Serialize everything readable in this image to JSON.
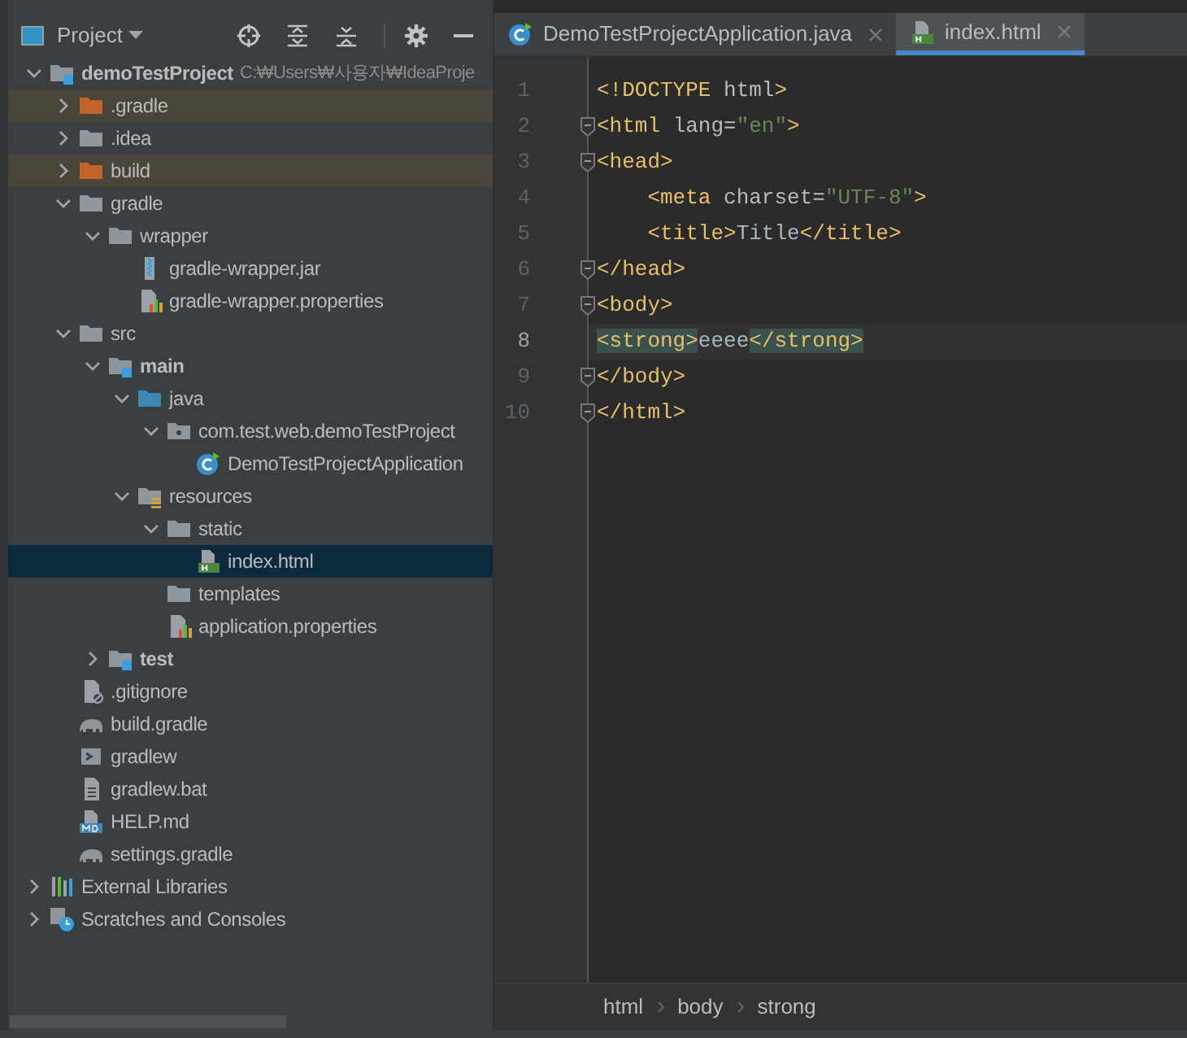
{
  "project_panel": {
    "title": "Project",
    "tree": [
      {
        "name": "demoTestProject",
        "kind": "module",
        "hint": "C:₩Users₩사용자₩IdeaProje",
        "expanded": true,
        "selected": false,
        "children": [
          {
            "name": ".gradle",
            "kind": "excluded-folder",
            "expanded": false,
            "selected": false
          },
          {
            "name": ".idea",
            "kind": "folder",
            "expanded": false,
            "selected": false
          },
          {
            "name": "build",
            "kind": "excluded-folder",
            "expanded": false,
            "selected": false
          },
          {
            "name": "gradle",
            "kind": "folder",
            "expanded": true,
            "selected": false,
            "children": [
              {
                "name": "wrapper",
                "kind": "folder",
                "expanded": true,
                "selected": false,
                "children": [
                  {
                    "name": "gradle-wrapper.jar",
                    "kind": "jar",
                    "selected": false
                  },
                  {
                    "name": "gradle-wrapper.properties",
                    "kind": "properties",
                    "selected": false
                  }
                ]
              }
            ]
          },
          {
            "name": "src",
            "kind": "folder",
            "expanded": true,
            "selected": false,
            "children": [
              {
                "name": "main",
                "kind": "module-folder",
                "expanded": true,
                "selected": false,
                "children": [
                  {
                    "name": "java",
                    "kind": "source-folder",
                    "expanded": true,
                    "selected": false,
                    "children": [
                      {
                        "name": "com.test.web.demoTestProject",
                        "kind": "package",
                        "expanded": true,
                        "selected": false,
                        "children": [
                          {
                            "name": "DemoTestProjectApplication",
                            "kind": "java-class",
                            "selected": false
                          }
                        ]
                      }
                    ]
                  },
                  {
                    "name": "resources",
                    "kind": "resources",
                    "expanded": true,
                    "selected": false,
                    "children": [
                      {
                        "name": "static",
                        "kind": "folder",
                        "expanded": true,
                        "selected": false,
                        "children": [
                          {
                            "name": "index.html",
                            "kind": "html",
                            "selected": true
                          }
                        ]
                      },
                      {
                        "name": "templates",
                        "kind": "folder",
                        "selected": false
                      },
                      {
                        "name": "application.properties",
                        "kind": "properties",
                        "selected": false
                      }
                    ]
                  }
                ]
              },
              {
                "name": "test",
                "kind": "module-folder",
                "expanded": false,
                "selected": false
              }
            ]
          },
          {
            "name": ".gitignore",
            "kind": "gitignore",
            "selected": false
          },
          {
            "name": "build.gradle",
            "kind": "gradle",
            "selected": false
          },
          {
            "name": "gradlew",
            "kind": "shell",
            "selected": false
          },
          {
            "name": "gradlew.bat",
            "kind": "bat",
            "selected": false
          },
          {
            "name": "HELP.md",
            "kind": "markdown",
            "selected": false
          },
          {
            "name": "settings.gradle",
            "kind": "gradle",
            "selected": false
          }
        ]
      },
      {
        "name": "External Libraries",
        "kind": "libraries",
        "expanded": false,
        "selected": false
      },
      {
        "name": "Scratches and Consoles",
        "kind": "scratches",
        "expanded": false,
        "selected": false
      }
    ]
  },
  "tabs": [
    {
      "label": "DemoTestProjectApplication.java",
      "kind": "java-class",
      "selected": false
    },
    {
      "label": "index.html",
      "kind": "html",
      "selected": true
    }
  ],
  "editor": {
    "lines": [
      {
        "number": "1",
        "fold": false,
        "current": false,
        "tokens": [
          {
            "t": "<!DOCTYPE ",
            "kind": "tag"
          },
          {
            "t": "html",
            "kind": "attr"
          },
          {
            "t": ">",
            "kind": "tag"
          }
        ]
      },
      {
        "number": "2",
        "fold": true,
        "current": false,
        "tokens": [
          {
            "t": "<html ",
            "kind": "tag"
          },
          {
            "t": "lang=",
            "kind": "attr"
          },
          {
            "t": "\"en\"",
            "kind": "string"
          },
          {
            "t": ">",
            "kind": "tag"
          }
        ]
      },
      {
        "number": "3",
        "fold": true,
        "current": false,
        "tokens": [
          {
            "t": "<head>",
            "kind": "tag"
          }
        ]
      },
      {
        "number": "4",
        "fold": false,
        "current": false,
        "tokens": [
          {
            "t": "    <meta ",
            "kind": "tag"
          },
          {
            "t": "charset=",
            "kind": "attr"
          },
          {
            "t": "\"UTF-8\"",
            "kind": "string"
          },
          {
            "t": ">",
            "kind": "tag"
          }
        ]
      },
      {
        "number": "5",
        "fold": false,
        "current": false,
        "tokens": [
          {
            "t": "    <title>",
            "kind": "tag"
          },
          {
            "t": "Title",
            "kind": "text"
          },
          {
            "t": "</title>",
            "kind": "tag"
          }
        ]
      },
      {
        "number": "6",
        "fold": true,
        "current": false,
        "tokens": [
          {
            "t": "</head>",
            "kind": "tag"
          }
        ]
      },
      {
        "number": "7",
        "fold": true,
        "current": false,
        "tokens": [
          {
            "t": "<body>",
            "kind": "tag"
          }
        ]
      },
      {
        "number": "8",
        "fold": false,
        "current": true,
        "tokens": [
          {
            "t": "<strong>",
            "kind": "tag",
            "matched": true
          },
          {
            "t": "eeee",
            "kind": "text"
          },
          {
            "t": "</strong>",
            "kind": "tag",
            "matched": true
          }
        ]
      },
      {
        "number": "9",
        "fold": true,
        "current": false,
        "tokens": [
          {
            "t": "</body>",
            "kind": "tag"
          }
        ]
      },
      {
        "number": "10",
        "fold": true,
        "current": false,
        "tokens": [
          {
            "t": "</html>",
            "kind": "tag"
          }
        ]
      }
    ]
  },
  "breadcrumbs": [
    "html",
    "body",
    "strong"
  ]
}
